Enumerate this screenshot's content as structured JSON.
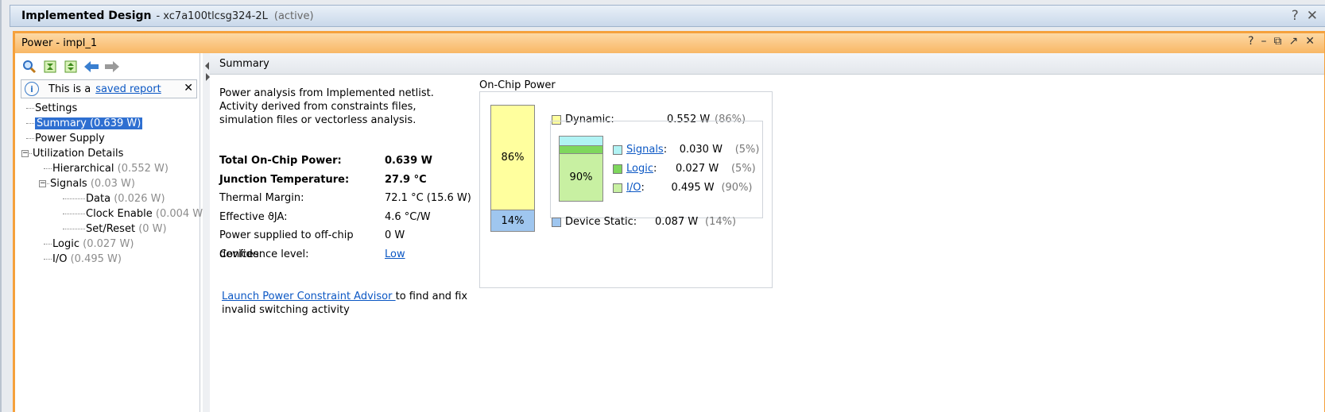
{
  "window": {
    "title": "Implemented Design",
    "part": "- xc7a100tlcsg324-2L",
    "status": "(active)",
    "help": "?",
    "close": "✕"
  },
  "panel": {
    "title": "Power - impl_1",
    "controls": [
      "?",
      "–",
      "⧉",
      "↗",
      "✕"
    ]
  },
  "banner": {
    "text": "This is a",
    "link": "saved report",
    "close": "✕"
  },
  "tree": {
    "settings": "Settings",
    "summary": "Summary (0.639 W)",
    "power_supply": "Power Supply",
    "utilization": "Utilization Details",
    "hierarchical": "Hierarchical",
    "hierarchical_val": "(0.552 W)",
    "signals": "Signals",
    "signals_val": "(0.03 W)",
    "data": "Data",
    "data_val": "(0.026 W)",
    "clock_enable": "Clock Enable",
    "clock_enable_val": "(0.004 W)",
    "set_reset": "Set/Reset",
    "set_reset_val": "(0 W)",
    "logic": "Logic",
    "logic_val": "(0.027 W)",
    "io": "I/O",
    "io_val": "(0.495 W)"
  },
  "tab": {
    "label": "Summary"
  },
  "summary": {
    "description": "Power analysis from Implemented netlist. Activity derived from constraints files, simulation files or vectorless analysis.",
    "rows": [
      {
        "key": "Total On-Chip Power:",
        "value": "0.639 W",
        "bold": true
      },
      {
        "key": "Junction Temperature:",
        "value": "27.9 °C",
        "bold": true
      },
      {
        "key": "Thermal Margin:",
        "value": "72.1 °C (15.6 W)"
      },
      {
        "key": "Effective ϑJA:",
        "value": "4.6 °C/W"
      },
      {
        "key": "Power supplied to off-chip devices:",
        "value": "0 W"
      },
      {
        "key": "Confidence level:",
        "value": "Low",
        "link": true
      }
    ],
    "advisor_link": "Launch Power Constraint Advisor ",
    "advisor_text": "to find and fix invalid switching activity"
  },
  "onchip": {
    "title": "On-Chip Power",
    "dynamic": {
      "label": "Dynamic:",
      "value": "0.552 W",
      "pct": "(86%)",
      "bar": "86%",
      "color": "#ffff9e",
      "fraction": 0.86
    },
    "static": {
      "label": "Device Static:",
      "value": "0.087 W",
      "pct": "(14%)",
      "bar": "14%",
      "color": "#9fc6ef",
      "fraction": 0.14
    },
    "sub_bar_label": "90%",
    "signals": {
      "label": "Signals",
      "value": "0.030 W",
      "pct": "(5%)",
      "color": "#b1f3f4"
    },
    "logic": {
      "label": "Logic",
      "value": "0.027 W",
      "pct": "(5%)",
      "color": "#7fd75d"
    },
    "io": {
      "label": "I/O",
      "value": "0.495 W",
      "pct": "(90%)",
      "color": "#c8f0a2"
    }
  }
}
